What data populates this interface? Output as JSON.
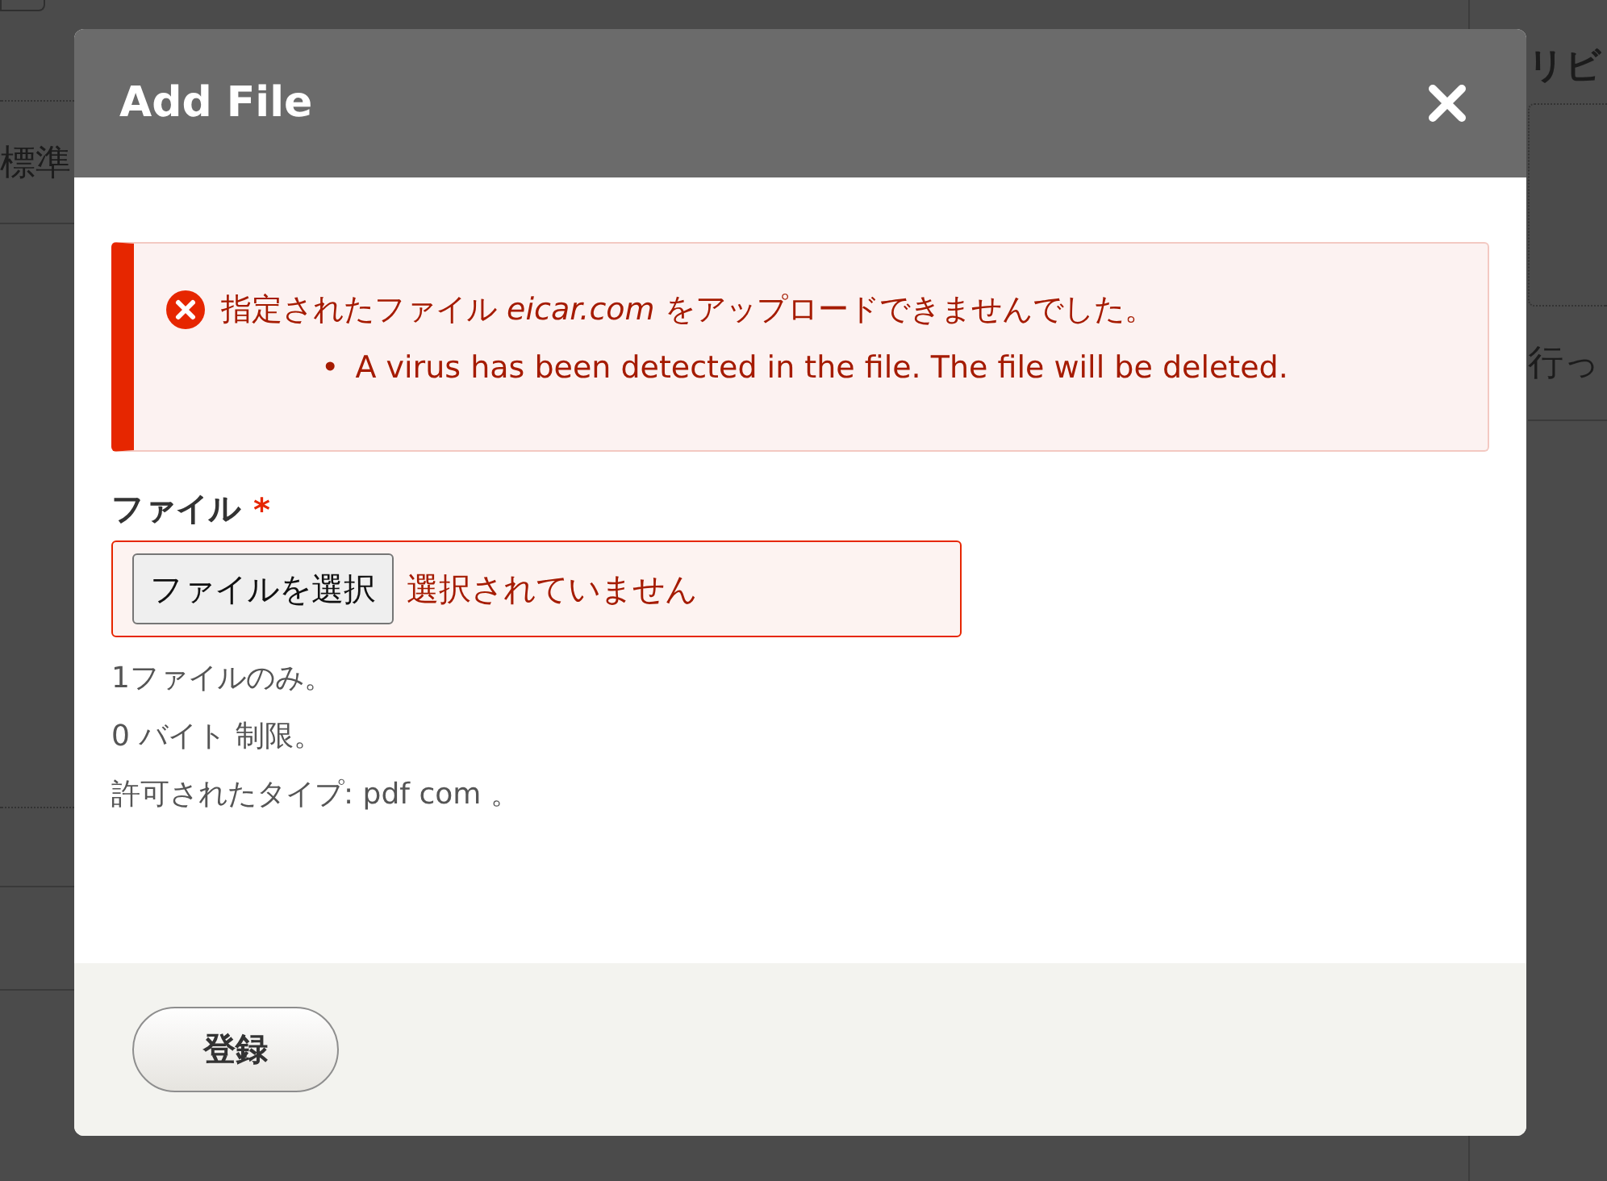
{
  "background": {
    "left_label": "標準",
    "right_subheading": "リビ",
    "right_text": "行っ"
  },
  "dialog": {
    "title": "Add File",
    "error": {
      "message": "指定されたファイル *eicar.com* をアップロードできませんでした。",
      "details": [
        {
          "bullet": "•",
          "text": "A virus has been detected in the file. The file will be deleted."
        }
      ]
    },
    "field": {
      "label": "ファイル",
      "required": true,
      "required_mark": "*",
      "invalid": true,
      "button": "ファイルを選択",
      "status": "選択されていません",
      "descriptions": [
        "1ファイルのみ。",
        "0 バイト 制限。",
        "許可されたタイプ: pdf com 。"
      ]
    },
    "submit": "登録"
  }
}
